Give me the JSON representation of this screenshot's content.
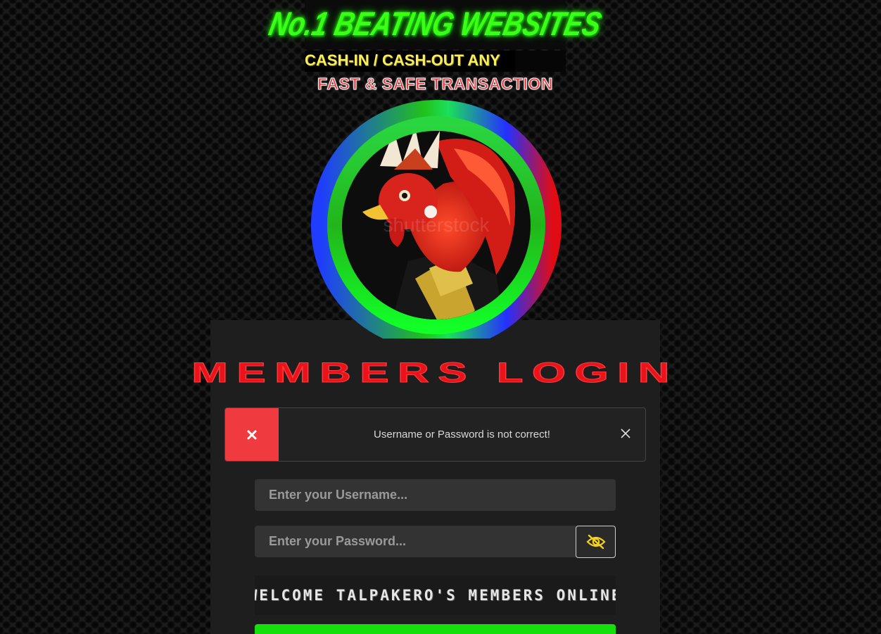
{
  "banner": {
    "headline": "No.1 BEATING WEBSITES",
    "cash_line": "CASH-IN / CASH-OUT ANY",
    "safe_line": "FAST & SAFE TRANSACTION"
  },
  "logo": {
    "description_icon": "rooster-mascot-icon",
    "watermark": "shutterstock"
  },
  "login": {
    "title": "MEMBERS LOGIN",
    "alert": {
      "message": "Username or Password is not correct!",
      "icon": "error-x-icon",
      "close_icon": "close-icon",
      "accent_color": "#ef3b3f"
    },
    "username_placeholder": "Enter your Username...",
    "password_placeholder": "Enter your Password...",
    "toggle_icon": "eye-slash-icon",
    "marquee_text": "WELCOME TALPAKERO'S MEMBERS ONLINE",
    "submit_color": "#16e00c"
  },
  "colors": {
    "background": "#1b1b1b",
    "panel": "#1e1e1e",
    "title_red": "#e8131b",
    "headline_green": "#3cff19",
    "cash_yellow": "#f6ee62"
  }
}
